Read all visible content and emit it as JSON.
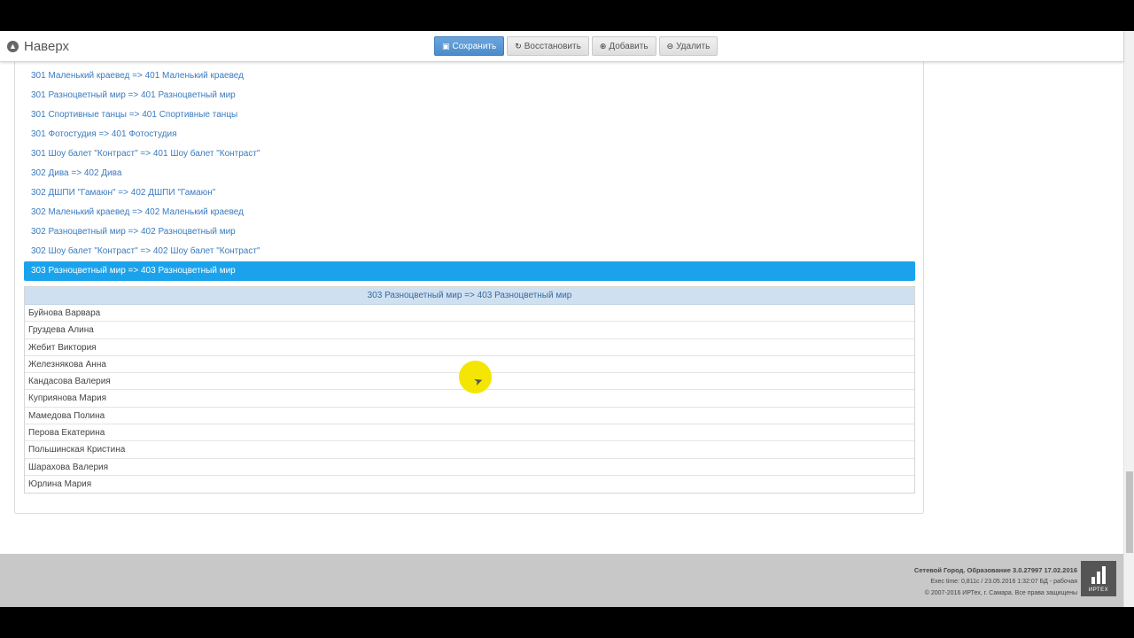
{
  "toolbar": {
    "back_label": "Наверх",
    "buttons": {
      "save": "Сохранить",
      "restore": "Восстановить",
      "add": "Добавить",
      "delete": "Удалить"
    },
    "icons": {
      "back": "arrow-up-circle-icon",
      "save": "floppy-icon",
      "restore": "refresh-icon",
      "add": "plus-circle-icon",
      "delete": "minus-circle-icon"
    }
  },
  "groups": [
    "301 Маленький краевед => 401 Маленький краевед",
    "301 Разноцветный мир => 401 Разноцветный мир",
    "301 Спортивные танцы => 401 Спортивные танцы",
    "301 Фотостудия => 401 Фотостудия",
    "301 Шоу балет \"Контраст\" => 401 Шоу балет \"Контраст\"",
    "302 Дива => 402 Дива",
    "302 ДШПИ \"Гамаюн\" => 402 ДШПИ \"Гамаюн\"",
    "302 Маленький краевед => 402 Маленький краевед",
    "302 Разноцветный мир => 402 Разноцветный мир",
    "302 Шоу балет \"Контраст\" => 402 Шоу балет \"Контраст\"",
    "303 Разноцветный мир => 403 Разноцветный мир"
  ],
  "selected_group_index": 10,
  "members": {
    "header": "303 Разноцветный мир => 403 Разноцветный мир",
    "rows": [
      "Буйнова Варвара",
      "Груздева Алина",
      "Жебит Виктория",
      "Железнякова Анна",
      "Кандасова Валерия",
      "Куприянова Мария",
      "Мамедова Полина",
      "Перова Екатерина",
      "Польшинская Кристина",
      "Шарахова Валерия",
      "Юрлина Мария"
    ]
  },
  "footer": {
    "line1": "Сетевой Город. Образование  3.0.27997  17.02.2016",
    "line2": "Exec time: 0,811с / 23.05.2016 1:32:07  БД - рабочая",
    "line3": "© 2007-2016 ИРТех, г. Самара. Все права защищены",
    "logo_text": "ИРТЕХ"
  },
  "colors": {
    "accent": "#1aa3ec",
    "link": "#3a7bbf",
    "header_bg": "#cfe0f0",
    "footer_bg": "#c8c8c8"
  }
}
